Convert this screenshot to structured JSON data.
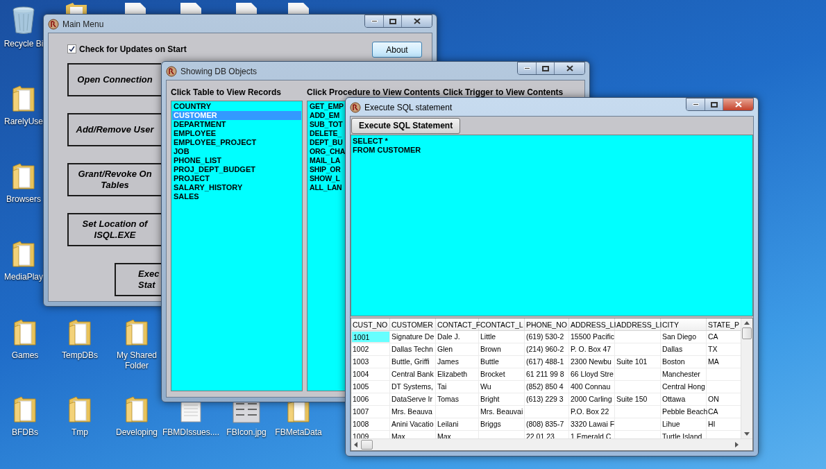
{
  "desktop": {
    "top_icons": [
      {
        "kind": "folder"
      },
      {
        "kind": "document"
      },
      {
        "kind": "document"
      },
      {
        "kind": "document"
      },
      {
        "kind": "document"
      }
    ],
    "icons": [
      {
        "label": "Recycle Bi",
        "kind": "recycle"
      },
      {
        "label": "RarelyUse",
        "kind": "folder"
      },
      {
        "label": "Browsers",
        "kind": "folder"
      },
      {
        "label": "MediaPlay",
        "kind": "folder"
      },
      {
        "label": "Games",
        "kind": "folder"
      },
      {
        "label": "BFDBs",
        "kind": "folder"
      },
      {
        "label": "TempDBs",
        "kind": "folder"
      },
      {
        "label": "Tmp",
        "kind": "folder"
      },
      {
        "label": "My Shared Folder",
        "kind": "folder"
      },
      {
        "label": "Developing",
        "kind": "folder"
      },
      {
        "label": "FBMDIssues....",
        "kind": "document"
      },
      {
        "label": "FBIcon.jpg",
        "kind": "image"
      },
      {
        "label": "FBMetaData",
        "kind": "folder"
      }
    ]
  },
  "main_menu": {
    "title": "Main Menu",
    "active": false,
    "check_updates": {
      "label": "Check for Updates on Start",
      "checked": true
    },
    "about_button": "About",
    "buttons": [
      {
        "lines": [
          "Open Connection"
        ]
      },
      {
        "lines": [
          "Add/Remove User"
        ]
      },
      {
        "lines": [
          "Grant/Revoke On",
          "Tables"
        ]
      },
      {
        "lines": [
          "Set Location of",
          "ISQL.EXE"
        ]
      },
      {
        "lines": [
          "Exec",
          "Stat"
        ]
      }
    ]
  },
  "db_objects": {
    "title": "Showing DB Objects",
    "active": false,
    "tables": {
      "heading": "Click Table to View Records",
      "items": [
        {
          "name": "COUNTRY",
          "selected": false
        },
        {
          "name": "CUSTOMER",
          "selected": true
        },
        {
          "name": "DEPARTMENT",
          "selected": false
        },
        {
          "name": "EMPLOYEE",
          "selected": false
        },
        {
          "name": "EMPLOYEE_PROJECT",
          "selected": false
        },
        {
          "name": "JOB",
          "selected": false
        },
        {
          "name": "PHONE_LIST",
          "selected": false
        },
        {
          "name": "PROJ_DEPT_BUDGET",
          "selected": false
        },
        {
          "name": "PROJECT",
          "selected": false
        },
        {
          "name": "SALARY_HISTORY",
          "selected": false
        },
        {
          "name": "SALES",
          "selected": false
        }
      ]
    },
    "procedures": {
      "heading": "Click Procedure to View  Contents",
      "items": [
        "GET_EMP",
        "ADD_EM",
        "SUB_TOT",
        "DELETE_",
        "DEPT_BU",
        "ORG_CHA",
        "MAIL_LA",
        "SHIP_OR",
        "SHOW_L",
        "ALL_LAN"
      ]
    },
    "triggers": {
      "heading": "Click Trigger to View  Contents"
    }
  },
  "sql_window": {
    "title": "Execute SQL statement",
    "active": true,
    "execute_button": "Execute SQL Statement",
    "query": "SELECT *\nFROM CUSTOMER",
    "grid": {
      "columns": [
        "CUST_NO",
        "CUSTOMER",
        "CONTACT_F",
        "CONTACT_L",
        "PHONE_NO",
        "ADDRESS_LI",
        "ADDRESS_LI",
        "CITY",
        "STATE_P"
      ],
      "rows": [
        {
          "selected": true,
          "cells": [
            "1001",
            "Signature De",
            "Dale J.",
            "Little",
            "(619) 530-2",
            "15500 Pacific",
            "",
            "San Diego",
            "CA"
          ]
        },
        {
          "selected": false,
          "cells": [
            "1002",
            "Dallas Techn",
            "Glen",
            "Brown",
            "(214) 960-2",
            "P. O. Box 47",
            "",
            "Dallas",
            "TX"
          ]
        },
        {
          "selected": false,
          "cells": [
            "1003",
            "Buttle, Griffi",
            "James",
            "Buttle",
            "(617) 488-1",
            "2300 Newbu",
            "Suite 101",
            "Boston",
            "MA"
          ]
        },
        {
          "selected": false,
          "cells": [
            "1004",
            "Central Bank",
            "Elizabeth",
            "Brocket",
            "61 211 99 8",
            "66 Lloyd Stre",
            "",
            "Manchester",
            ""
          ]
        },
        {
          "selected": false,
          "cells": [
            "1005",
            "DT Systems,",
            "Tai",
            "Wu",
            "(852) 850 4",
            "400 Connau",
            "",
            "Central Hong",
            ""
          ]
        },
        {
          "selected": false,
          "cells": [
            "1006",
            "DataServe Ir",
            "Tomas",
            "Bright",
            "(613) 229 3",
            "2000 Carling",
            "Suite 150",
            "Ottawa",
            "ON"
          ]
        },
        {
          "selected": false,
          "cells": [
            "1007",
            "Mrs. Beauva",
            "",
            "Mrs. Beauvai",
            "",
            "P.O. Box 22",
            "",
            "Pebble Beach",
            "CA"
          ]
        },
        {
          "selected": false,
          "cells": [
            "1008",
            "Anini Vacatio",
            "Leilani",
            "Briggs",
            "(808) 835-7",
            "3320 Lawai F",
            "",
            "Lihue",
            "HI"
          ]
        },
        {
          "selected": false,
          "cells": [
            "1009",
            "Max",
            "Max",
            "",
            "22 01 23",
            "1 Emerald C",
            "",
            "Turtle Island",
            ""
          ]
        }
      ]
    }
  }
}
